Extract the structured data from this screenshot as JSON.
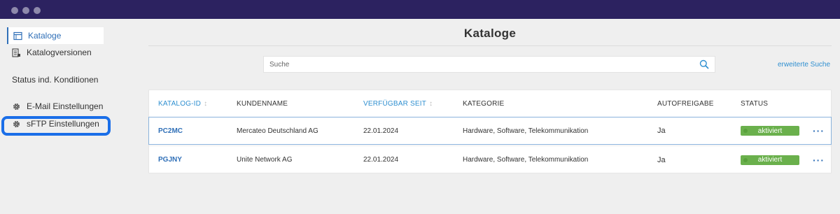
{
  "window": {
    "dots": [
      "dot-1",
      "dot-2",
      "dot-3"
    ]
  },
  "sidebar": {
    "items": [
      {
        "label": "Kataloge",
        "icon": "catalog-icon",
        "active": true
      },
      {
        "label": "Katalogversionen",
        "icon": "catalog-versions-icon"
      },
      {
        "label": "Status ind. Konditionen"
      },
      {
        "label": "E-Mail Einstellungen",
        "icon": "gear-icon"
      },
      {
        "label": "sFTP Einstellungen",
        "icon": "gear-icon",
        "highlighted": true
      }
    ]
  },
  "page": {
    "title": "Kataloge"
  },
  "search": {
    "placeholder": "Suche",
    "value": "",
    "advanced_label": "erweiterte Suche"
  },
  "table": {
    "columns": [
      {
        "label": "KATALOG-ID",
        "sortable": true
      },
      {
        "label": "KUNDENNAME",
        "sortable": false
      },
      {
        "label": "VERFÜGBAR SEIT",
        "sortable": true
      },
      {
        "label": "KATEGORIE",
        "sortable": false
      },
      {
        "label": "AUTOFREIGABE",
        "sortable": false
      },
      {
        "label": "STATUS",
        "sortable": false
      }
    ],
    "rows": [
      {
        "id": "PC2MC",
        "customer": "Mercateo Deutschland AG",
        "since": "22.01.2024",
        "category": "Hardware, Software, Telekommunikation",
        "auto": "Ja",
        "status": "aktiviert",
        "more": "···"
      },
      {
        "id": "PGJNY",
        "customer": "Unite Network AG",
        "since": "22.01.2024",
        "category": "Hardware, Software, Telekommunikation",
        "auto": "Ja",
        "status": "aktiviert",
        "more": "···"
      }
    ]
  },
  "colors": {
    "titlebar": "#2c2260",
    "accent": "#2f6fb7",
    "link": "#2f8fd0",
    "status_green": "#6ab04c",
    "highlight": "#1a6ee8"
  }
}
